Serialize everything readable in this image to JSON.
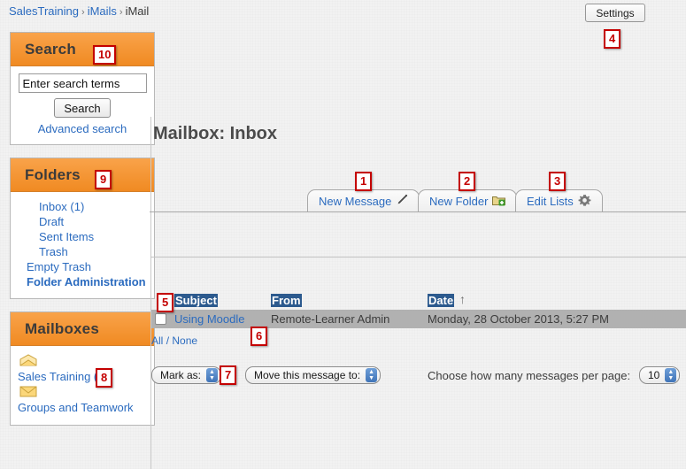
{
  "breadcrumb": {
    "items": [
      {
        "label": "SalesTraining",
        "link": true
      },
      {
        "label": "iMails",
        "link": true
      },
      {
        "label": "iMail",
        "link": false
      }
    ],
    "separator": "›"
  },
  "header": {
    "settings_label": "Settings"
  },
  "page": {
    "title": "Mailbox: Inbox"
  },
  "callouts": [
    {
      "id": "1",
      "label": "1"
    },
    {
      "id": "2",
      "label": "2"
    },
    {
      "id": "3",
      "label": "3"
    },
    {
      "id": "4",
      "label": "4"
    },
    {
      "id": "5",
      "label": "5"
    },
    {
      "id": "6",
      "label": "6"
    },
    {
      "id": "7",
      "label": "7"
    },
    {
      "id": "8",
      "label": "8"
    },
    {
      "id": "9",
      "label": "9"
    },
    {
      "id": "10",
      "label": "10"
    }
  ],
  "sidebar": {
    "search_block": {
      "title": "Search",
      "input_value": "",
      "input_placeholder": "Enter search terms",
      "button_label": "Search",
      "advanced_link": "Advanced search"
    },
    "folders_block": {
      "title": "Folders",
      "items": [
        {
          "label": "Inbox (1)",
          "indent": 2,
          "bold": false
        },
        {
          "label": "Draft",
          "indent": 2,
          "bold": false
        },
        {
          "label": "Sent Items",
          "indent": 2,
          "bold": false
        },
        {
          "label": "Trash",
          "indent": 2,
          "bold": false
        },
        {
          "label": "Empty Trash",
          "indent": 1,
          "bold": false
        },
        {
          "label": "Folder Administration",
          "indent": 1,
          "bold": true
        }
      ]
    },
    "mailboxes_block": {
      "title": "Mailboxes",
      "items": [
        {
          "label": "Sales Training",
          "count": "(1)",
          "icon": "open-envelope-icon"
        },
        {
          "label": "Groups and Teamwork",
          "count": "",
          "icon": "closed-envelope-icon"
        }
      ]
    }
  },
  "tabs": [
    {
      "label": "New Message",
      "icon": "pencil-icon"
    },
    {
      "label": "New Folder",
      "icon": "folder-add-icon"
    },
    {
      "label": "Edit Lists",
      "icon": "gear-icon"
    }
  ],
  "message_table": {
    "columns": [
      "Subject",
      "From",
      "Date"
    ],
    "sort_column": "Date",
    "sort_direction": "ascending",
    "sort_arrow": "↑",
    "rows": [
      {
        "selected": false,
        "subject": "Using Moodle",
        "from": "Remote-Learner Admin",
        "date": "Monday, 28 October 2013, 5:27 PM"
      }
    ],
    "select_all_label": "All",
    "select_none_label": "None",
    "select_separator": "/"
  },
  "controls": {
    "mark_as_label": "Mark as:",
    "move_to_label": "Move this message to:",
    "per_page_label": "Choose how many messages per page:",
    "per_page_value": "10"
  },
  "colors": {
    "accent_orange": "#f08a22",
    "link_blue": "#2b6bbf",
    "callout_red": "#c40000",
    "header_blue": "#2c5a8e",
    "row_gray": "#b1b1b1",
    "page_bg": "#f2f2f2"
  }
}
